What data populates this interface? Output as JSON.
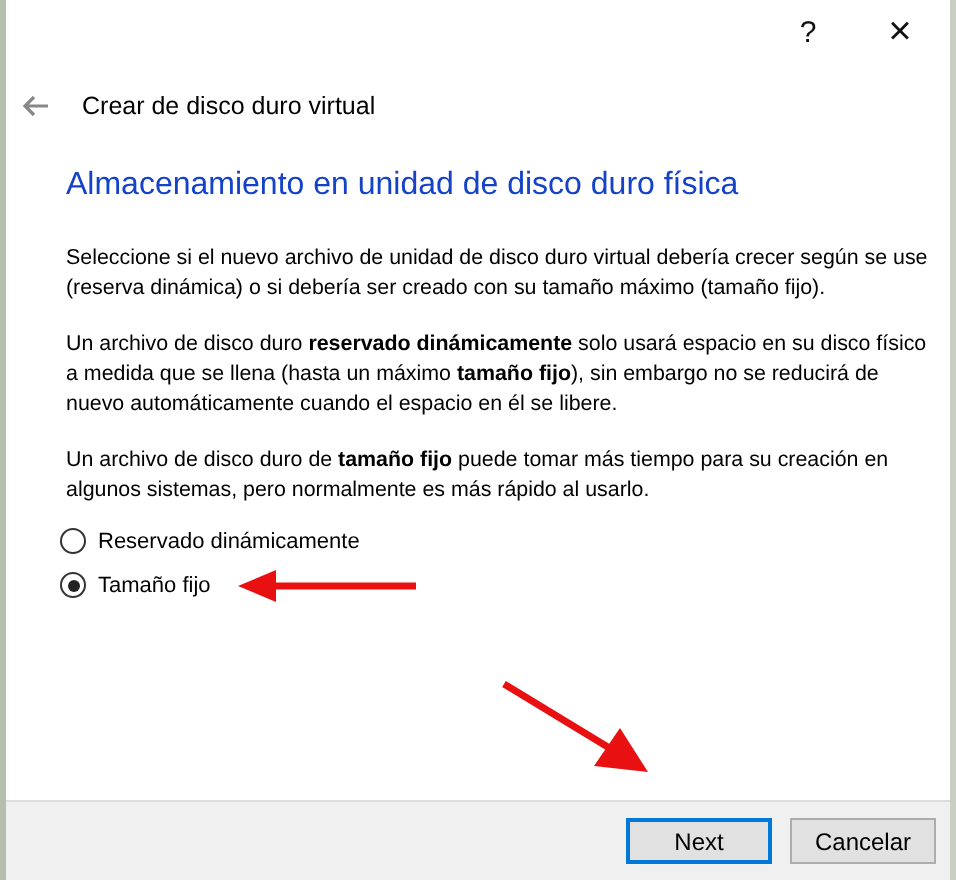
{
  "window": {
    "help": "?",
    "close": "×"
  },
  "header": {
    "title": "Crear de disco duro virtual"
  },
  "heading": "Almacenamiento en unidad de disco duro física",
  "paragraphs": [
    "Seleccione si el nuevo archivo de unidad de disco duro virtual debería crecer según se use (reserva dinámica) o si debería ser creado con su tamaño máximo (tamaño fijo).",
    "Un archivo de disco duro **reservado dinámicamente** solo usará espacio en su disco físico a medida que se llena (hasta un máximo **tamaño fijo**), sin embargo no se reducirá de nuevo automáticamente cuando el espacio en él se libere.",
    "Un archivo de disco duro de **tamaño fijo** puede tomar más tiempo para su creación en algunos sistemas, pero normalmente es más rápido al usarlo."
  ],
  "options": [
    {
      "label": "Reservado dinámicamente",
      "selected": false
    },
    {
      "label": "Tamaño fijo",
      "selected": true
    }
  ],
  "buttons": [
    {
      "label": "Next",
      "default": true
    },
    {
      "label": "Cancelar",
      "default": false
    }
  ]
}
